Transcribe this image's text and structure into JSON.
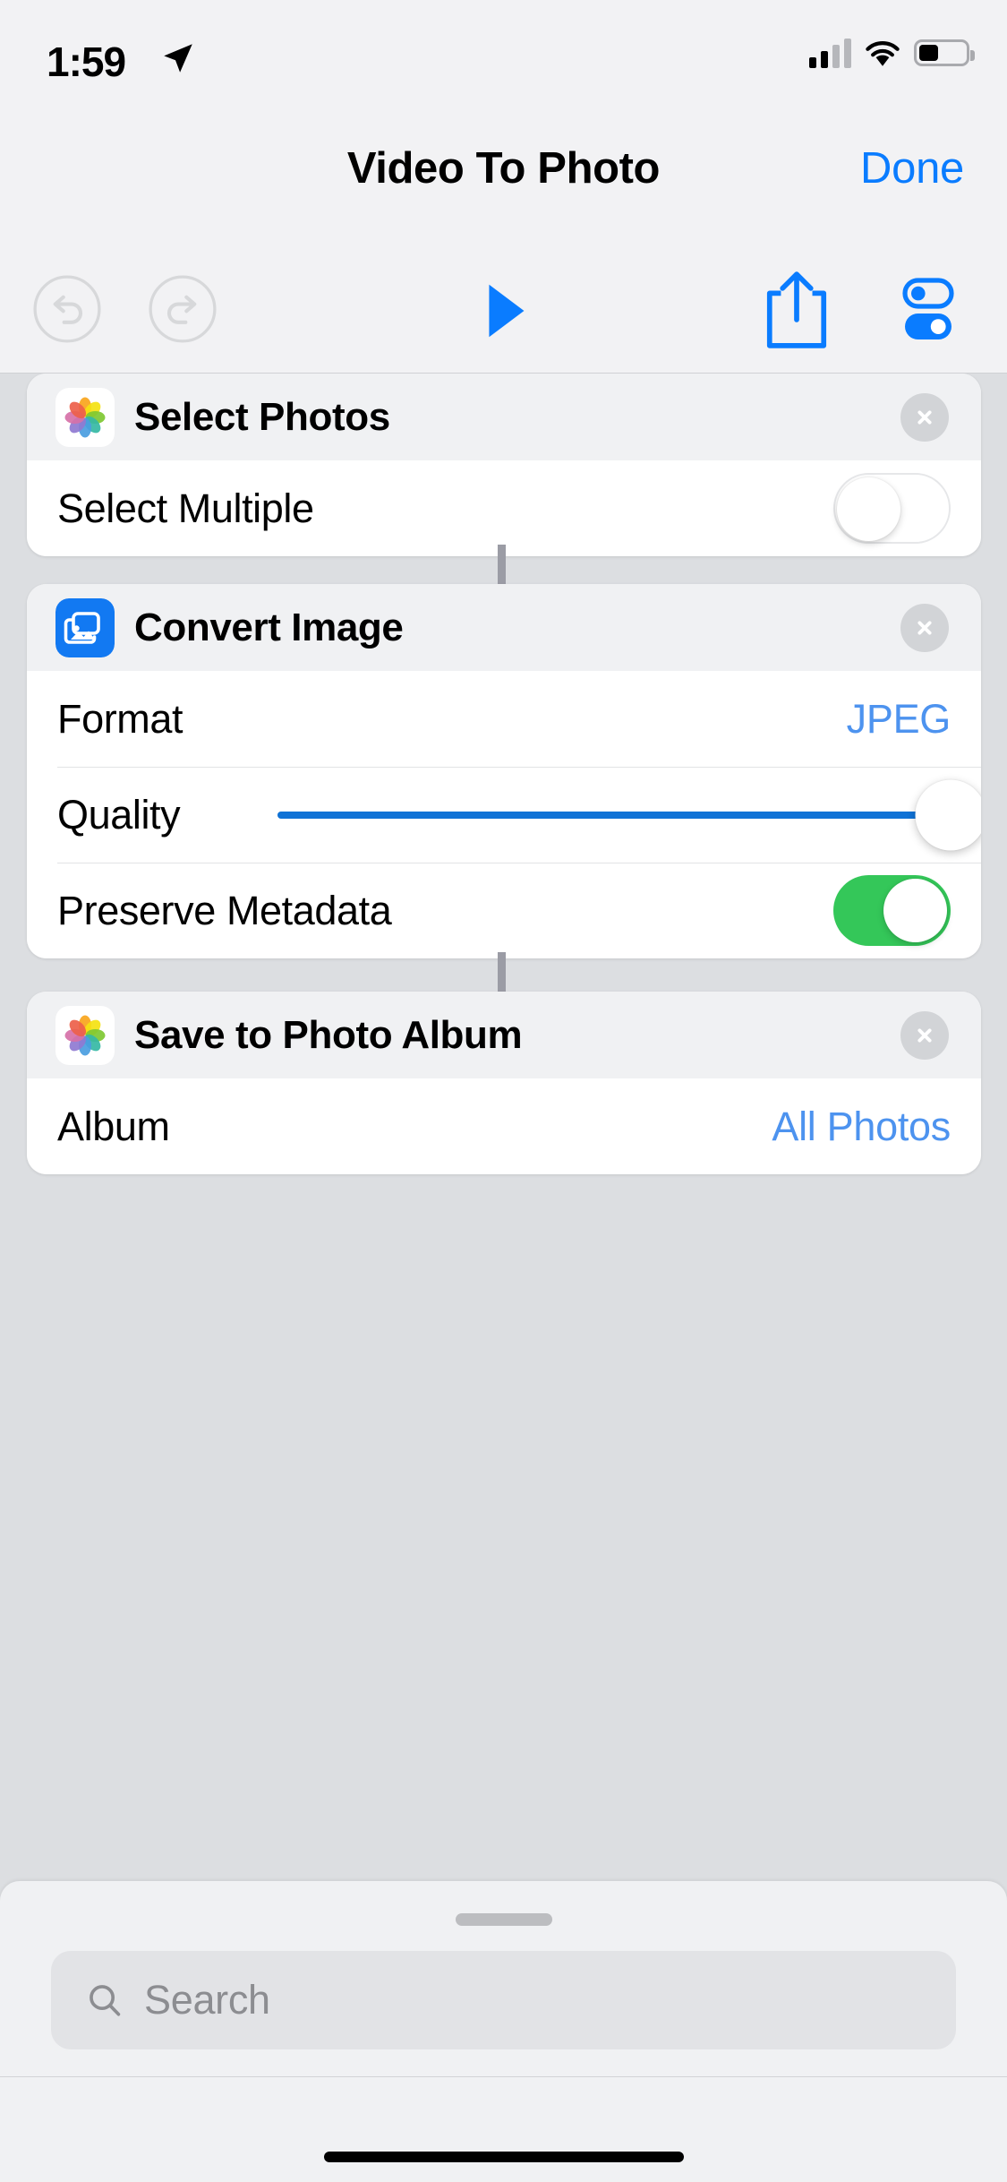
{
  "status_bar": {
    "time": "1:59",
    "location_icon": "location-arrow-icon",
    "cellular_icon": "cellular-signal-icon",
    "wifi_icon": "wifi-icon",
    "battery_icon": "battery-icon"
  },
  "nav": {
    "title": "Video To Photo",
    "done_label": "Done"
  },
  "toolbar": {
    "undo_icon": "undo-icon",
    "redo_icon": "redo-icon",
    "play_icon": "play-icon",
    "share_icon": "share-icon",
    "settings_icon": "toggles-icon"
  },
  "colors": {
    "accent_blue": "#0a7cff",
    "value_blue": "#4d93ef",
    "toggle_green": "#34c759",
    "slider_blue": "#0f72d6",
    "page_background": "#dcdee1"
  },
  "actions": [
    {
      "title": "Select Photos",
      "icon": "photos-app-icon",
      "close_icon": "close-icon",
      "rows": [
        {
          "label": "Select Multiple",
          "control": "toggle",
          "value": "off"
        }
      ]
    },
    {
      "title": "Convert Image",
      "icon": "convert-image-icon",
      "close_icon": "close-icon",
      "rows": [
        {
          "label": "Format",
          "control": "value",
          "value": "JPEG"
        },
        {
          "label": "Quality",
          "control": "slider",
          "value": "100"
        },
        {
          "label": "Preserve Metadata",
          "control": "toggle",
          "value": "on"
        }
      ]
    },
    {
      "title": "Save to Photo Album",
      "icon": "photos-app-icon",
      "close_icon": "close-icon",
      "rows": [
        {
          "label": "Album",
          "control": "value",
          "value": "All Photos"
        }
      ]
    }
  ],
  "sheet": {
    "grabber": "grabber-handle",
    "search": {
      "icon": "search-icon",
      "placeholder": "Search",
      "value": ""
    },
    "home_indicator": "home-indicator"
  }
}
